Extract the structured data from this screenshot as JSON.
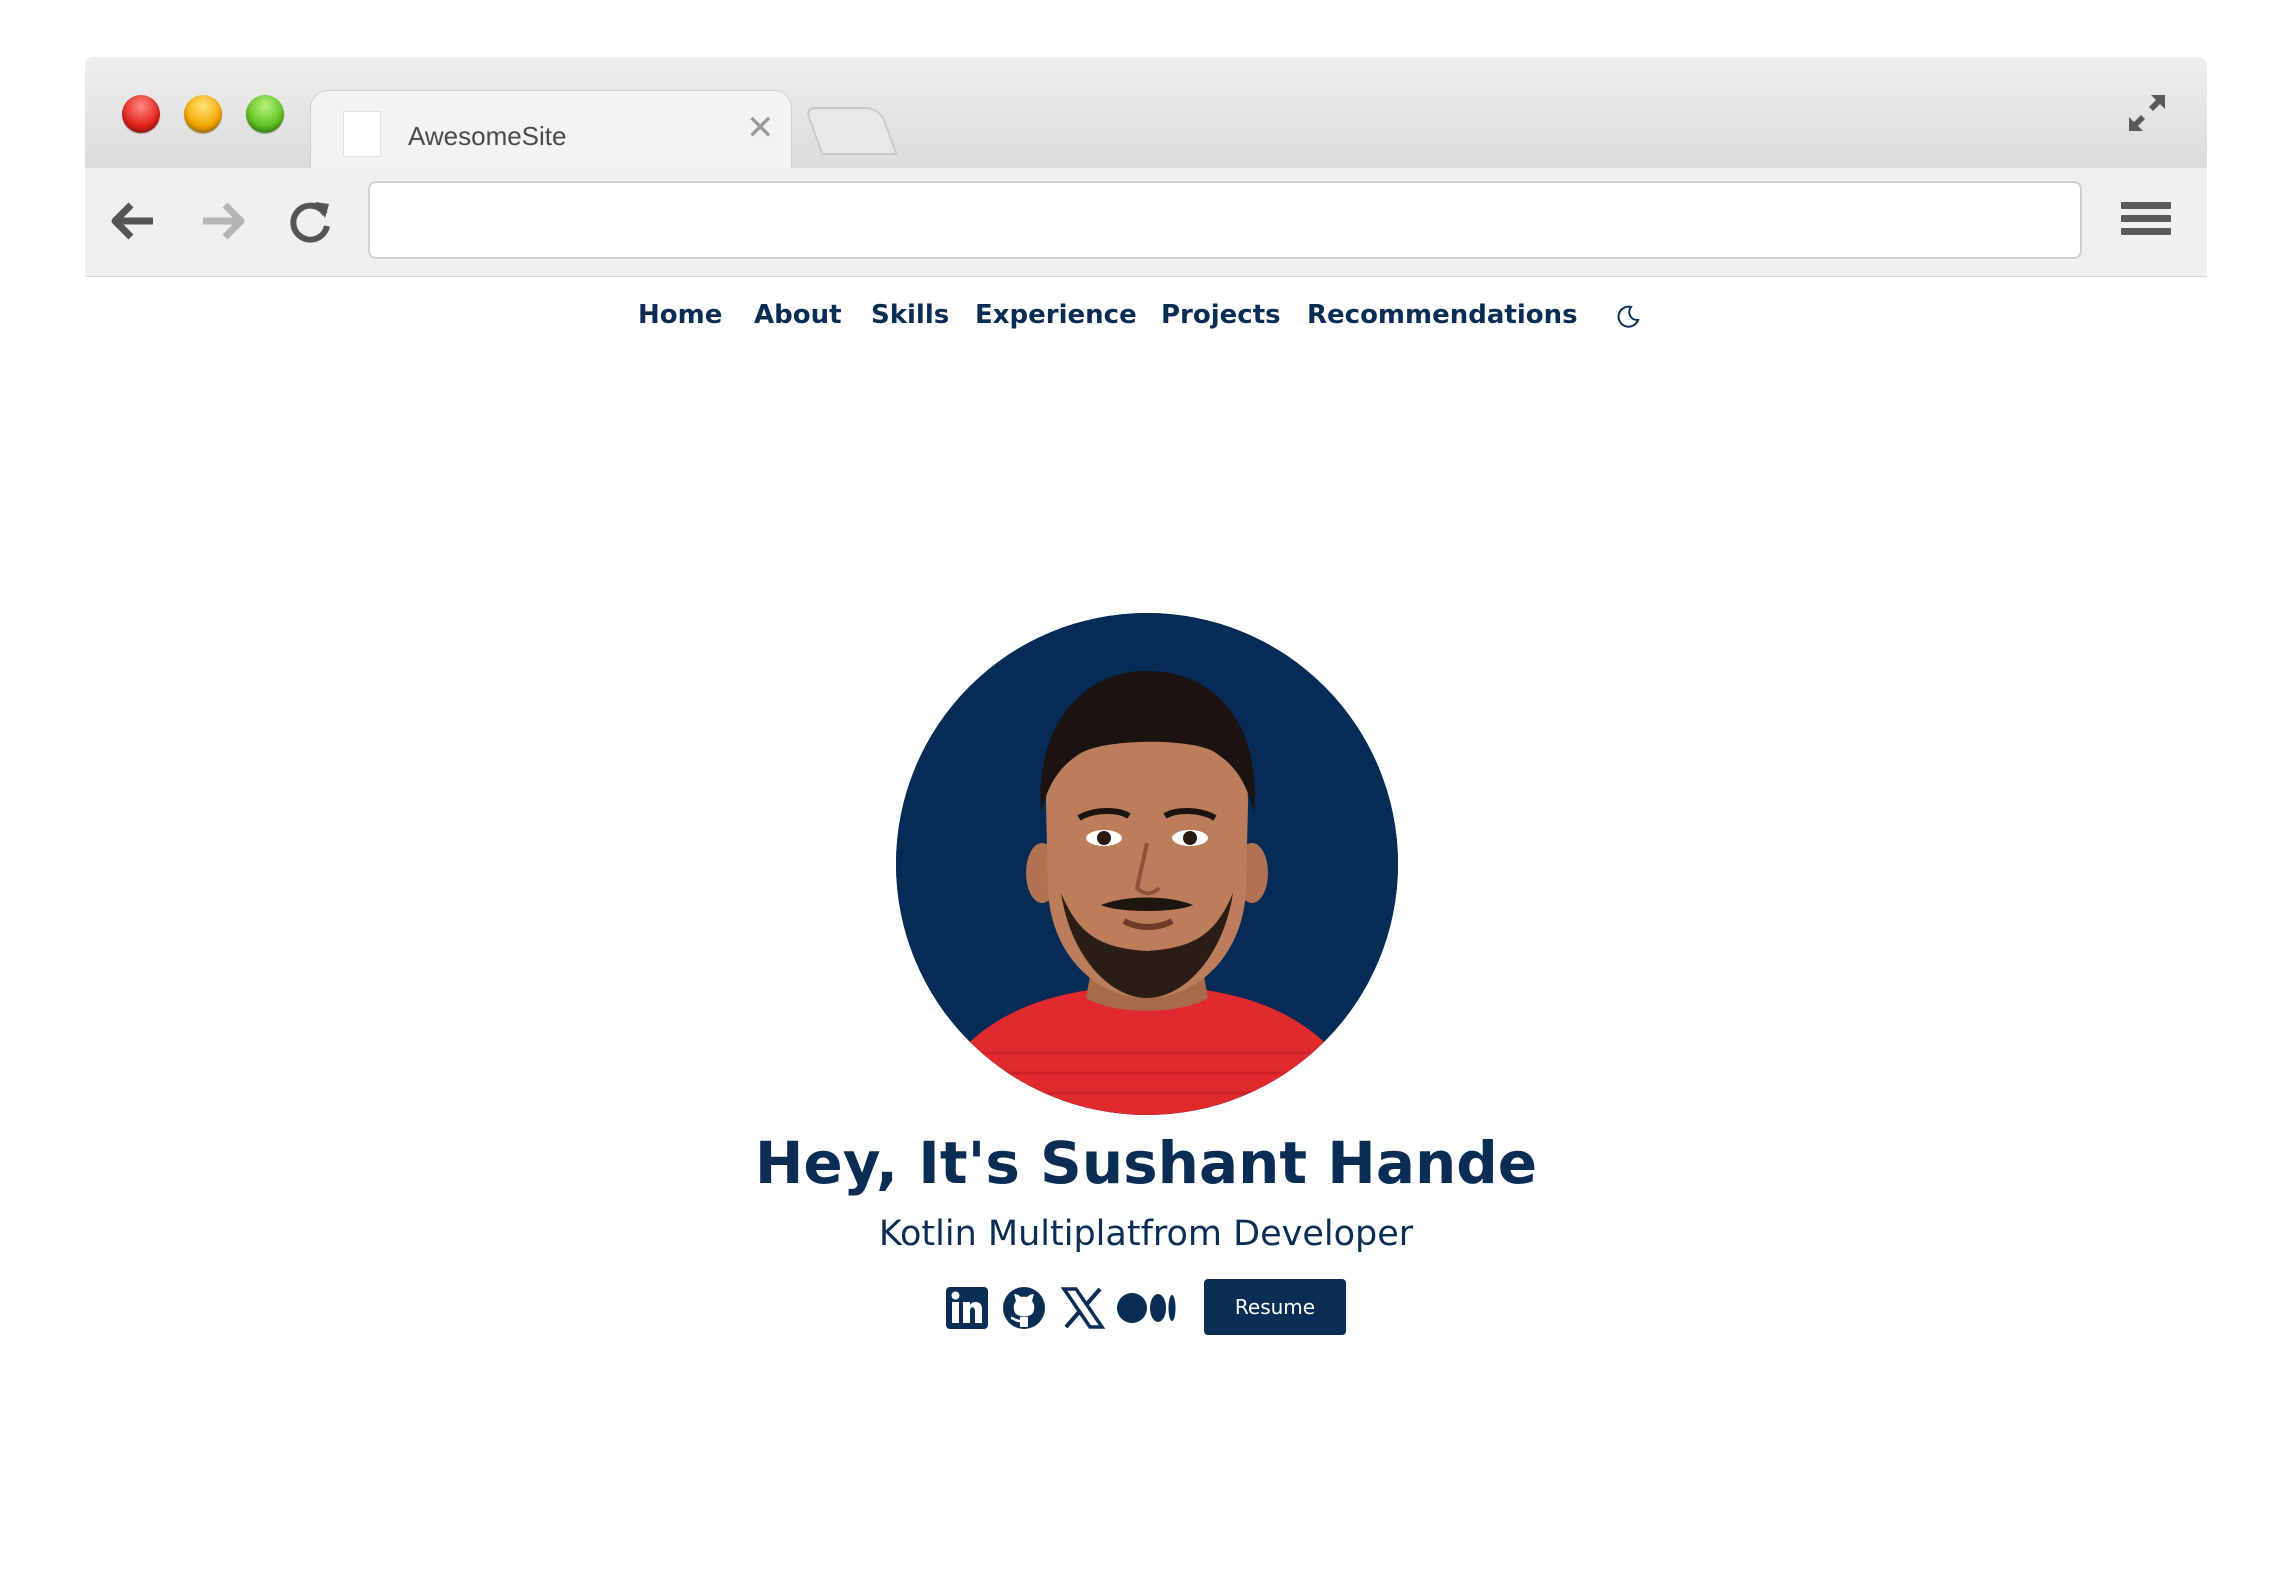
{
  "browser": {
    "tab_title": "AwesomeSite",
    "url": "",
    "icons": {
      "close": "close-icon",
      "back": "arrow-left-icon",
      "forward": "arrow-right-icon",
      "reload": "reload-icon",
      "menu": "hamburger-menu-icon",
      "expand": "expand-icon"
    }
  },
  "site": {
    "nav": {
      "items": [
        "Home",
        "About",
        "Skills",
        "Experience",
        "Projects",
        "Recommendations"
      ],
      "theme_toggle_icon": "moon-icon"
    },
    "hero": {
      "title": "Hey, It's Sushant Hande",
      "subtitle": "Kotlin Multiplatfrom Developer",
      "social_icons": [
        "linkedin-icon",
        "github-icon",
        "x-icon",
        "medium-icon"
      ],
      "resume_label": "Resume"
    },
    "colors": {
      "brand": "#0a2d55",
      "avatar_bg": "#042c57",
      "shirt": "#e02a2e"
    }
  }
}
